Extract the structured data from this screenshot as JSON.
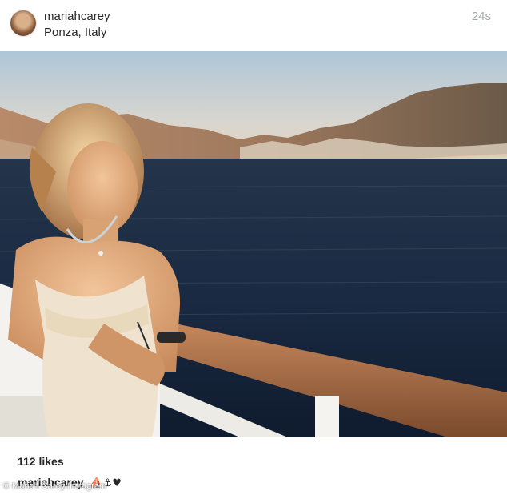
{
  "post": {
    "username": "mariahcarey",
    "location": "Ponza, Italy",
    "timestamp": "24s",
    "avatar_icon": "profile-avatar",
    "photo_description_icon": "post-photo",
    "likes": "112 likes",
    "caption": {
      "username": "mariahcarey",
      "emoji": "⛵⚓♥"
    }
  },
  "watermark": "© Mariah Carey/Instagram"
}
